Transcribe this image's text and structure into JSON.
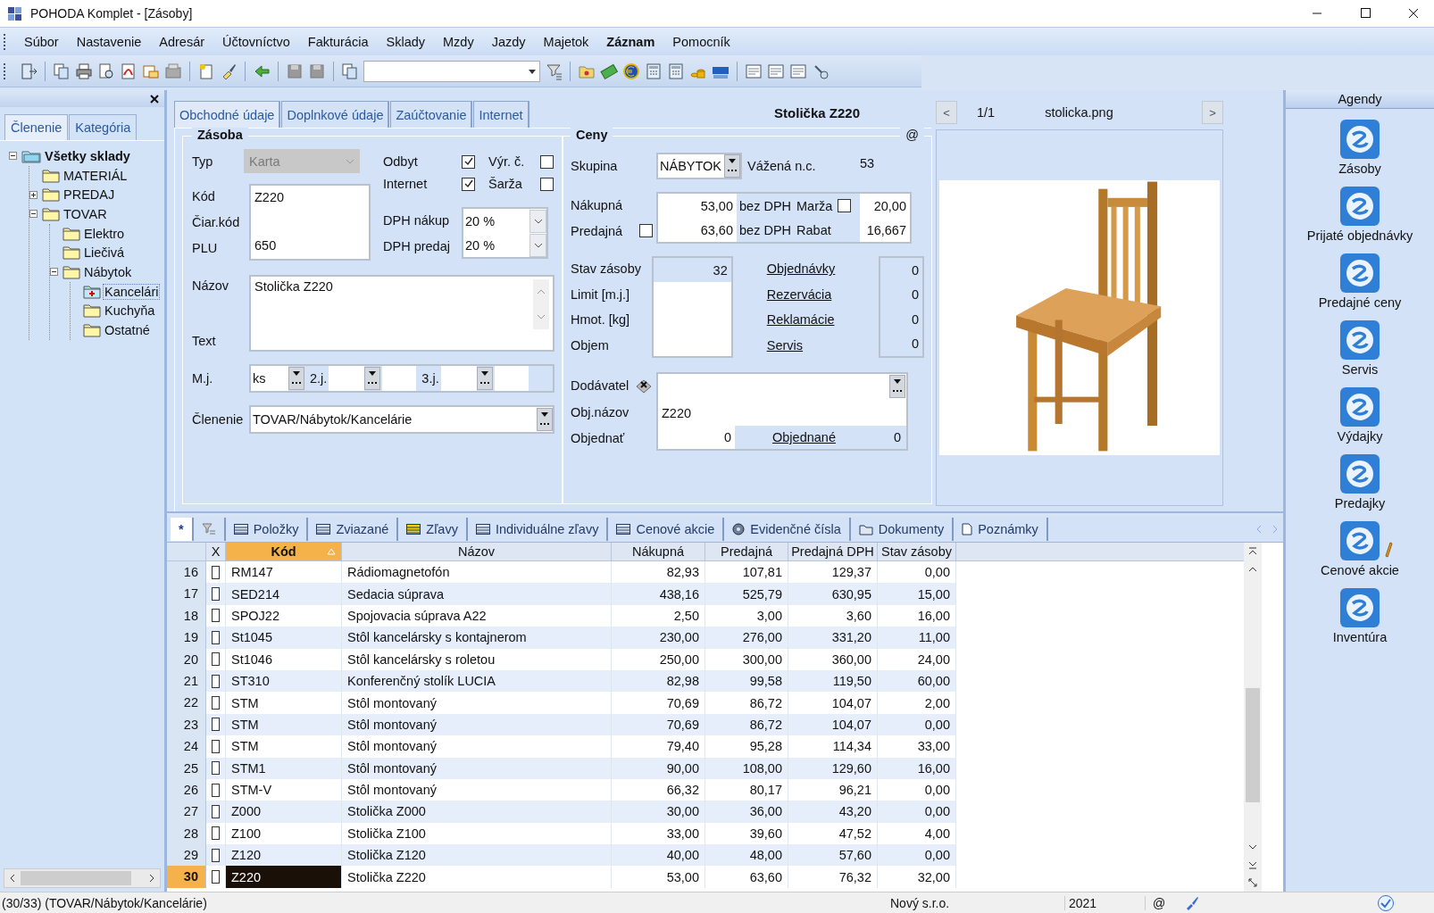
{
  "window": {
    "title": "POHODA Komplet - [Zásoby]"
  },
  "menu": [
    {
      "label": "Súbor",
      "bold": false
    },
    {
      "label": "Nastavenie",
      "bold": false
    },
    {
      "label": "Adresár",
      "bold": false
    },
    {
      "label": "Účtovníctvo",
      "bold": false
    },
    {
      "label": "Fakturácia",
      "bold": false
    },
    {
      "label": "Sklady",
      "bold": false
    },
    {
      "label": "Mzdy",
      "bold": false
    },
    {
      "label": "Jazdy",
      "bold": false
    },
    {
      "label": "Majetok",
      "bold": false
    },
    {
      "label": "Záznam",
      "bold": true
    },
    {
      "label": "Pomocník",
      "bold": false
    }
  ],
  "left_panel": {
    "tabs": [
      {
        "label": "Členenie",
        "selected": true
      },
      {
        "label": "Kategória",
        "selected": false
      }
    ],
    "tree": [
      {
        "label": "Všetky sklady",
        "kind": "root",
        "selected": false,
        "expanded": true,
        "children": [
          {
            "label": "MATERIÁL",
            "kind": "folder",
            "selected": false
          },
          {
            "label": "PREDAJ",
            "kind": "folder",
            "selected": false,
            "expanded": false
          },
          {
            "label": "TOVAR",
            "kind": "folder",
            "selected": false,
            "expanded": true,
            "children": [
              {
                "label": "Elektro",
                "kind": "folder",
                "selected": false
              },
              {
                "label": "Liečivá",
                "kind": "folder",
                "selected": false
              },
              {
                "label": "Nábytok",
                "kind": "folder",
                "selected": false,
                "expanded": true,
                "children": [
                  {
                    "label": "Kancelári",
                    "kind": "folder",
                    "selected": true
                  },
                  {
                    "label": "Kuchyňa",
                    "kind": "folder",
                    "selected": false
                  },
                  {
                    "label": "Ostatné",
                    "kind": "folder",
                    "selected": false
                  }
                ]
              }
            ]
          }
        ]
      }
    ]
  },
  "record": {
    "tabs": [
      {
        "label": "Obchodné údaje",
        "selected": true
      },
      {
        "label": "Doplnkové údaje",
        "selected": false
      },
      {
        "label": "Zaúčtovanie",
        "selected": false
      },
      {
        "label": "Internet",
        "selected": false
      }
    ],
    "title": "Stolička Z220"
  },
  "zasoba": {
    "title": "Zásoba",
    "typ_label": "Typ",
    "typ": "Karta",
    "typ_disabled": true,
    "checks": [
      {
        "label": "Odbyt",
        "checked": true
      },
      {
        "label": "Výr. č.",
        "checked": false
      },
      {
        "label": "Internet",
        "checked": true
      },
      {
        "label": "Šarža",
        "checked": false
      }
    ],
    "codes": [
      {
        "label": "Kód",
        "value": "Z220"
      },
      {
        "label": "Čiar.kód"
      },
      {
        "label": "PLU",
        "value": "650"
      }
    ],
    "vat": [
      {
        "label": "DPH nákup",
        "value": "20 %"
      },
      {
        "label": "DPH predaj",
        "value": "20 %"
      }
    ],
    "nazov_label": "Názov",
    "nazov": "Stolička Z220",
    "text_label": "Text",
    "units": {
      "label": "M.j.",
      "value": "ks",
      "second_label": "2.j.",
      "third_label": "3.j."
    },
    "clenenie": {
      "label": "Členenie",
      "value": "TOVAR/Nábytok/Kancelárie"
    }
  },
  "ceny": {
    "title": "Ceny",
    "at": "@",
    "skupina_label": "Skupina",
    "skupina": "NÁBYTOK",
    "vazena_label": "Vážená n.c.",
    "vazena": "53",
    "nakupna": {
      "label": "Nákupná",
      "value": "53,00",
      "unit": "bez DPH",
      "extra_label": "Marža",
      "extra_checked": false,
      "extra_value": "20,00"
    },
    "predajna": {
      "label": "Predajná",
      "checked": false,
      "value": "63,60",
      "unit": "bez DPH",
      "extra_label": "Rabat",
      "extra_value": "16,667"
    },
    "stock": [
      {
        "label": "Stav zásoby",
        "value": "32"
      },
      {
        "label": "Limit  [m.j.]"
      },
      {
        "label": "Hmot. [kg]"
      },
      {
        "label": "Objem"
      }
    ],
    "links": [
      {
        "label": "Objednávky",
        "value": "0"
      },
      {
        "label": "Rezervácia",
        "value": "0"
      },
      {
        "label": "Reklamácie",
        "value": "0"
      },
      {
        "label": "Servis",
        "value": "0"
      }
    ],
    "dodavatel_label": "Dodávatel",
    "obj_nazov_label": "Obj.názov",
    "obj_nazov": "Z220",
    "objednat_label": "Objednať",
    "objednat": "0",
    "objednane_label": "Objednané",
    "objednane": "0"
  },
  "image": {
    "prev": "<",
    "counter": "1/1",
    "filename": "stolicka.png",
    "next": ">"
  },
  "bottom_tabs": [
    {
      "label": "*",
      "kind": "star",
      "selected": true
    },
    {
      "kind": "filter",
      "selected": false
    },
    {
      "label": "Položky",
      "kind": "table",
      "selected": false
    },
    {
      "label": "Zviazané",
      "kind": "table",
      "selected": false
    },
    {
      "label": "Zľavy",
      "kind": "discount",
      "selected": false
    },
    {
      "label": "Individuálne zľavy",
      "kind": "table",
      "selected": false
    },
    {
      "label": "Cenové akcie",
      "kind": "table",
      "selected": false
    },
    {
      "label": "Evidenčné čísla",
      "kind": "disc",
      "selected": false
    },
    {
      "label": "Dokumenty",
      "kind": "folder",
      "selected": false
    },
    {
      "label": "Poznámky",
      "kind": "page",
      "selected": false
    }
  ],
  "grid": {
    "check_column": {
      "label": "X"
    },
    "columns": [
      {
        "label": "Kód",
        "sorted": true
      },
      {
        "label": "Názov",
        "sorted": false
      },
      {
        "label": "Nákupná",
        "sorted": false
      },
      {
        "label": "Predajná",
        "sorted": false
      },
      {
        "label": "Predajná DPH",
        "sorted": false
      },
      {
        "label": "Stav zásoby",
        "sorted": false
      }
    ],
    "rows": [
      {
        "number": "16",
        "checked": false,
        "selected": false,
        "cells": [
          "RM147",
          "Rádiomagnetofón",
          "82,93",
          "107,81",
          "129,37",
          "0,00"
        ]
      },
      {
        "number": "17",
        "checked": false,
        "selected": false,
        "cells": [
          "SED214",
          "Sedacia súprava",
          "438,16",
          "525,79",
          "630,95",
          "15,00"
        ]
      },
      {
        "number": "18",
        "checked": false,
        "selected": false,
        "cells": [
          "SPOJ22",
          "Spojovacia súprava A22",
          "2,50",
          "3,00",
          "3,60",
          "16,00"
        ]
      },
      {
        "number": "19",
        "checked": false,
        "selected": false,
        "cells": [
          "St1045",
          "Stôl kancelársky s kontajnerom",
          "230,00",
          "276,00",
          "331,20",
          "11,00"
        ]
      },
      {
        "number": "20",
        "checked": false,
        "selected": false,
        "cells": [
          "St1046",
          "Stôl kancelársky s roletou",
          "250,00",
          "300,00",
          "360,00",
          "24,00"
        ]
      },
      {
        "number": "21",
        "checked": false,
        "selected": false,
        "cells": [
          "ST310",
          "Konferenčný stolík LUCIA",
          "82,98",
          "99,58",
          "119,50",
          "60,00"
        ]
      },
      {
        "number": "22",
        "checked": false,
        "selected": false,
        "cells": [
          "STM",
          "Stôl montovaný",
          "70,69",
          "86,72",
          "104,07",
          "2,00"
        ]
      },
      {
        "number": "23",
        "checked": false,
        "selected": false,
        "cells": [
          "STM",
          "Stôl montovaný",
          "70,69",
          "86,72",
          "104,07",
          "0,00"
        ]
      },
      {
        "number": "24",
        "checked": false,
        "selected": false,
        "cells": [
          "STM",
          "Stôl montovaný",
          "79,40",
          "95,28",
          "114,34",
          "33,00"
        ]
      },
      {
        "number": "25",
        "checked": false,
        "selected": false,
        "cells": [
          "STM1",
          "Stôl montovaný",
          "90,00",
          "108,00",
          "129,60",
          "16,00"
        ]
      },
      {
        "number": "26",
        "checked": false,
        "selected": false,
        "cells": [
          "STM-V",
          "Stôl montovaný",
          "66,32",
          "80,17",
          "96,21",
          "0,00"
        ]
      },
      {
        "number": "27",
        "checked": false,
        "selected": false,
        "cells": [
          "Z000",
          "Stolička Z000",
          "30,00",
          "36,00",
          "43,20",
          "0,00"
        ]
      },
      {
        "number": "28",
        "checked": false,
        "selected": false,
        "cells": [
          "Z100",
          "Stolička Z100",
          "33,00",
          "39,60",
          "47,52",
          "4,00"
        ]
      },
      {
        "number": "29",
        "checked": false,
        "selected": false,
        "cells": [
          "Z120",
          "Stolička Z120",
          "40,00",
          "48,00",
          "57,60",
          "0,00"
        ]
      },
      {
        "number": "30",
        "checked": false,
        "selected": true,
        "cells": [
          "Z220",
          "Stolička Z220",
          "53,00",
          "63,60",
          "76,32",
          "32,00"
        ]
      }
    ]
  },
  "agendas": {
    "title": "Agendy",
    "items": [
      {
        "label": "Zásoby",
        "pencil": false
      },
      {
        "label": "Prijaté objednávky",
        "pencil": false
      },
      {
        "label": "Predajné ceny",
        "pencil": false
      },
      {
        "label": "Servis",
        "pencil": false
      },
      {
        "label": "Výdajky",
        "pencil": false
      },
      {
        "label": "Predajky",
        "pencil": false
      },
      {
        "label": "Cenové akcie",
        "pencil": true
      },
      {
        "label": "Inventúra",
        "pencil": false
      }
    ]
  },
  "status": {
    "record": "(30/33) (TOVAR/Nábytok/Kancelárie)",
    "company": "Nový s.r.o.",
    "year": "2021",
    "at": "@"
  }
}
